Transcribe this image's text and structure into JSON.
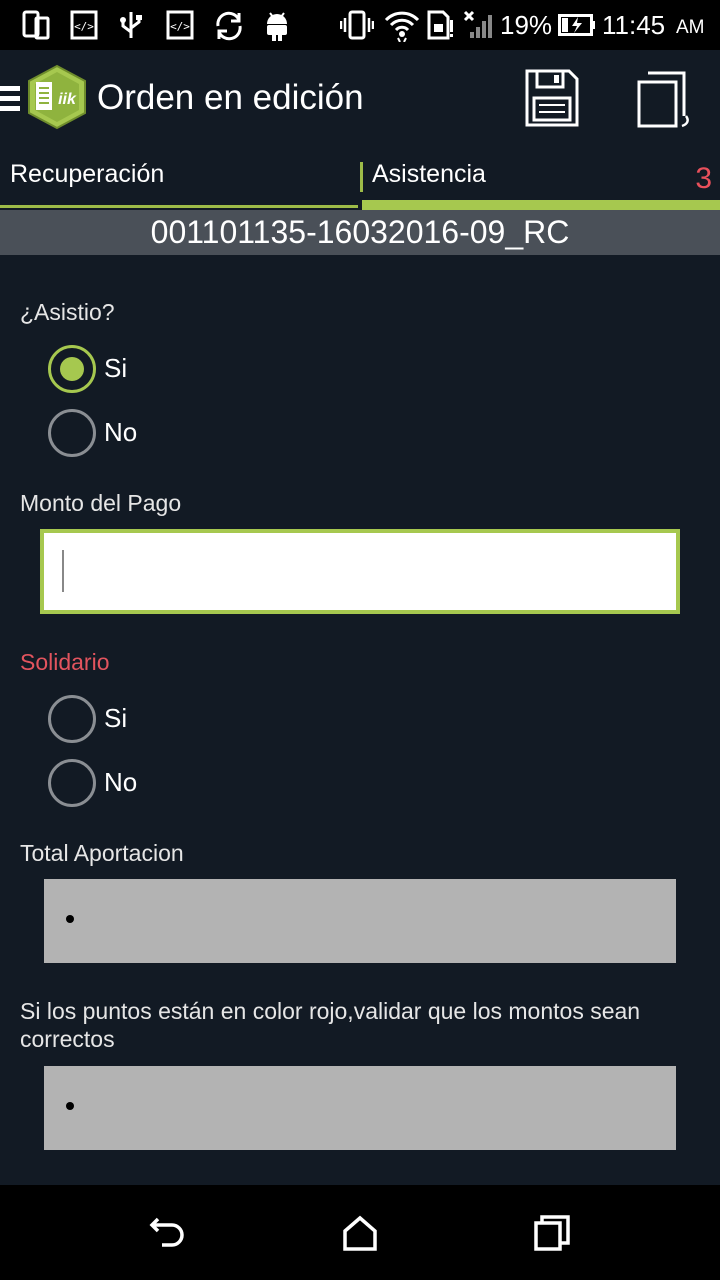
{
  "status_bar": {
    "battery_percent": "19%",
    "time": "11:45",
    "ampm": "AM",
    "icons": [
      "phone-icon",
      "code-icon",
      "usb-icon",
      "code-icon",
      "sync-icon",
      "android-icon",
      "vibrate-icon",
      "wifi-icon",
      "sim-icon",
      "no-signal-icon",
      "battery-icon"
    ]
  },
  "app_bar": {
    "title": "Orden en edición",
    "logo_text": "iik",
    "actions": [
      "save-icon",
      "copy-icon"
    ]
  },
  "tabs": [
    {
      "label": "Recuperación",
      "active": false
    },
    {
      "label": "Asistencia",
      "active": true,
      "badge": "3"
    }
  ],
  "order_id": "001101135-16032016-09_RC",
  "form": {
    "asistio": {
      "label": "¿Asistio?",
      "options": [
        {
          "label": "Si",
          "checked": true
        },
        {
          "label": "No",
          "checked": false
        }
      ]
    },
    "monto_pago": {
      "label": "Monto del Pago",
      "value": "",
      "placeholder": ""
    },
    "solidario": {
      "label": "Solidario",
      "options": [
        {
          "label": "Si",
          "checked": false
        },
        {
          "label": "No",
          "checked": false
        }
      ]
    },
    "total_aportacion": {
      "label": "Total Aportacion"
    },
    "info": {
      "text": "Si los puntos están en color rojo,validar que los montos sean correctos"
    }
  },
  "colors": {
    "accent": "#a6c84f",
    "background": "#121a24",
    "header_bar": "#4a5058",
    "warning_text": "#e2545e",
    "readonly_box": "#b3b3b3"
  },
  "nav_bar": [
    "back-icon",
    "home-icon",
    "recents-icon"
  ]
}
